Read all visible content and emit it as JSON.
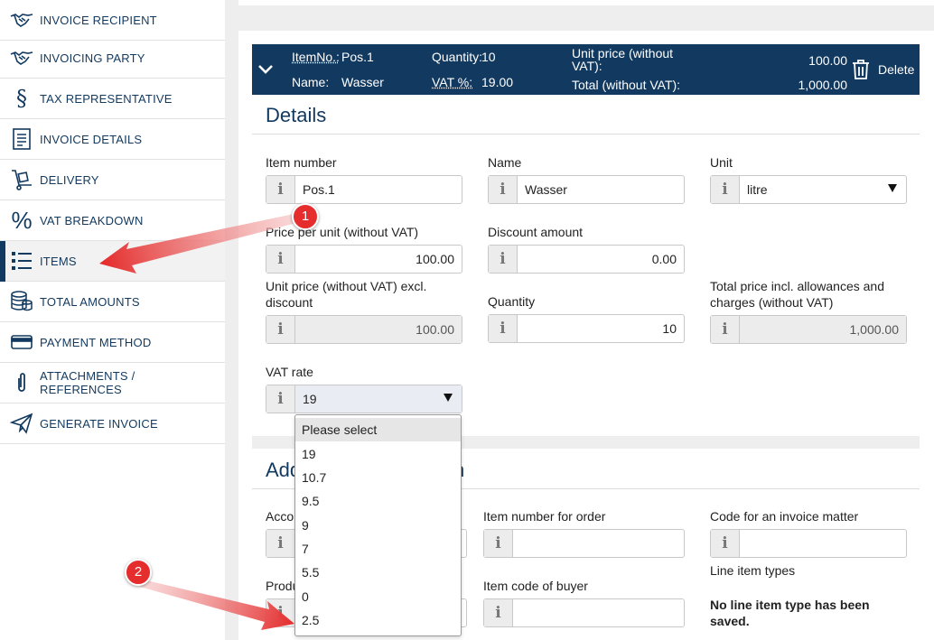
{
  "sidebar": {
    "items": [
      {
        "label": "INVOICE RECIPIENT",
        "icon": "handshake-icon"
      },
      {
        "label": "INVOICING PARTY",
        "icon": "handshake-icon"
      },
      {
        "label": "TAX REPRESENTATIVE",
        "icon": "section-sign-icon"
      },
      {
        "label": "INVOICE DETAILS",
        "icon": "document-icon"
      },
      {
        "label": "DELIVERY",
        "icon": "hand-truck-icon"
      },
      {
        "label": "VAT BREAKDOWN",
        "icon": "percent-icon"
      },
      {
        "label": "ITEMS",
        "icon": "list-icon"
      },
      {
        "label": "TOTAL AMOUNTS",
        "icon": "coins-icon"
      },
      {
        "label": "PAYMENT METHOD",
        "icon": "credit-card-icon"
      },
      {
        "label": "ATTACHMENTS / REFERENCES",
        "icon": "paperclip-icon"
      },
      {
        "label": "GENERATE INVOICE",
        "icon": "paper-plane-icon"
      }
    ],
    "active": "ITEMS"
  },
  "itembar": {
    "itemno_label": "ItemNo.:",
    "itemno_value": "Pos.1",
    "name_label": "Name:",
    "name_value": "Wasser",
    "quantity_label": "Quantity:",
    "quantity_value": "10",
    "vat_label": "VAT %:",
    "vat_value": "19.00",
    "unit_price_label": "Unit price (without VAT):",
    "unit_price_value": "100.00",
    "total_label": "Total (without VAT):",
    "total_value": "1,000.00",
    "delete_label": "Delete"
  },
  "details": {
    "title": "Details",
    "item_number": {
      "label": "Item number",
      "value": "Pos.1"
    },
    "name": {
      "label": "Name",
      "value": "Wasser"
    },
    "unit": {
      "label": "Unit",
      "value": "litre"
    },
    "price_per_unit": {
      "label": "Price per unit (without VAT)",
      "value": "100.00"
    },
    "discount_amount": {
      "label": "Discount amount",
      "value": "0.00"
    },
    "unit_price_excl_discount": {
      "label": "Unit price (without VAT) excl. discount",
      "value": "100.00"
    },
    "quantity": {
      "label": "Quantity",
      "value": "10"
    },
    "total_price": {
      "label": "Total price incl. allowances and charges (without VAT)",
      "value": "1,000.00"
    },
    "vat_rate": {
      "label": "VAT rate",
      "value": "19"
    }
  },
  "vat_dropdown": {
    "options": [
      "Please select",
      "19",
      "10.7",
      "9.5",
      "9",
      "7",
      "5.5",
      "0",
      "2.5"
    ]
  },
  "additional": {
    "title_visible_start": "Add",
    "title_visible_end": "n",
    "account_label_fragment": "Acco",
    "product_label_fragment": "Produ",
    "item_number_for_order": {
      "label": "Item number for order",
      "value": ""
    },
    "code_invoice_matter": {
      "label": "Code for an invoice matter",
      "value": ""
    },
    "item_code_buyer": {
      "label": "Item code of buyer",
      "value": ""
    },
    "line_item_types_label": "Line item types",
    "line_item_types_empty": "No line item type has been saved."
  },
  "annotations": {
    "badge_1": "1",
    "badge_2": "2",
    "color": "#e52d2d"
  },
  "colors": {
    "brand": "#12395f",
    "background": "#eeeeee"
  }
}
